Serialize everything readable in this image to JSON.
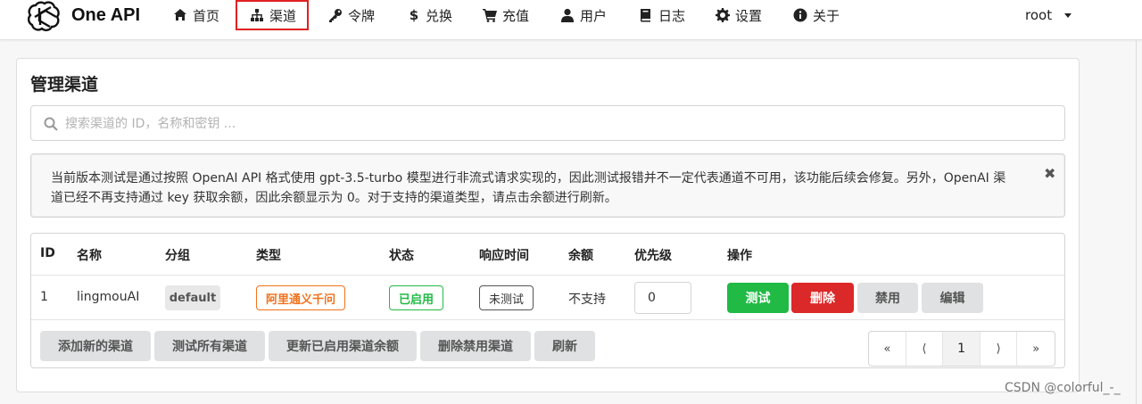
{
  "brand": {
    "name": "One API"
  },
  "nav": {
    "items": [
      {
        "label": "首页",
        "icon": "home-icon"
      },
      {
        "label": "渠道",
        "icon": "sitemap-icon"
      },
      {
        "label": "令牌",
        "icon": "key-icon"
      },
      {
        "label": "兑换",
        "icon": "dollar-icon"
      },
      {
        "label": "充值",
        "icon": "cart-icon"
      },
      {
        "label": "用户",
        "icon": "user-icon"
      },
      {
        "label": "日志",
        "icon": "book-icon"
      },
      {
        "label": "设置",
        "icon": "gear-icon"
      },
      {
        "label": "关于",
        "icon": "info-icon"
      }
    ],
    "active": "渠道",
    "user": "root"
  },
  "page": {
    "title": "管理渠道",
    "search_placeholder": "搜索渠道的 ID，名称和密钥 ...",
    "notice_line1": "当前版本测试是通过按照 OpenAI API 格式使用 gpt-3.5-turbo 模型进行非流式请求实现的，因此测试报错并不一定代表通道不可用，该功能后续会修复。另外，OpenAI 渠",
    "notice_line2": "道已经不再支持通过 key 获取余额，因此余额显示为 0。对于支持的渠道类型，请点击余额进行刷新。",
    "notice_close": "✖"
  },
  "table": {
    "headers": [
      "ID",
      "名称",
      "分组",
      "类型",
      "状态",
      "响应时间",
      "余额",
      "优先级",
      "操作"
    ],
    "rows": [
      {
        "id": "1",
        "name": "lingmouAI",
        "group": "default",
        "type": "阿里通义千问",
        "status": "已启用",
        "response_time": "未测试",
        "balance": "不支持",
        "priority": "0",
        "actions": {
          "test": "测试",
          "delete": "删除",
          "disable": "禁用",
          "edit": "编辑"
        }
      }
    ]
  },
  "footer_buttons": {
    "add": "添加新的渠道",
    "test_all": "测试所有渠道",
    "update_balance": "更新已启用渠道余额",
    "delete_disabled": "删除禁用渠道",
    "refresh": "刷新"
  },
  "pagination": {
    "first": "«",
    "prev": "⟨",
    "current": "1",
    "next": "⟩",
    "last": "»"
  },
  "watermark": "CSDN @colorful_-_",
  "colors": {
    "success": "#21ba45",
    "danger": "#db2828",
    "warning": "#f2711c",
    "highlight": "#e02020"
  }
}
